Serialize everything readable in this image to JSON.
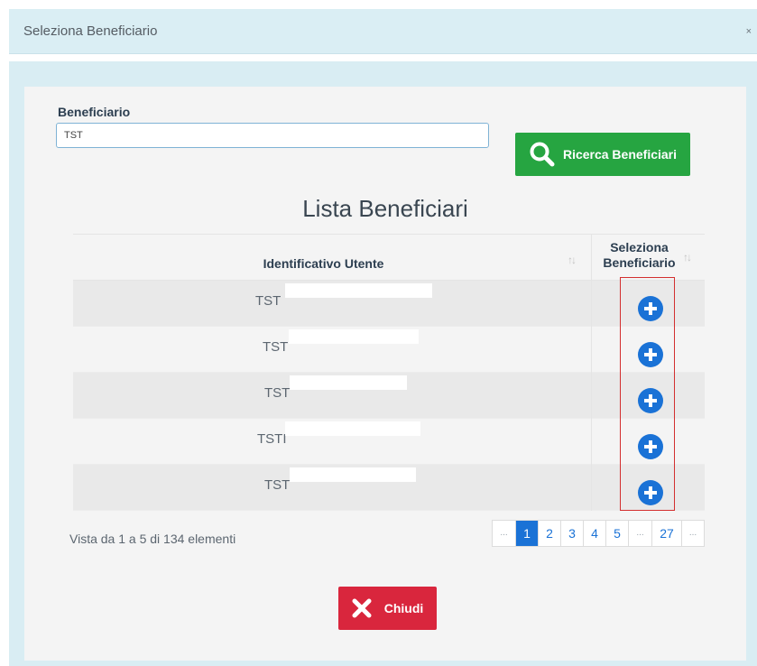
{
  "modal": {
    "title": "Seleziona Beneficiario",
    "close_symbol": "×"
  },
  "search": {
    "label": "Beneficiario",
    "value": "TST",
    "button_label": "Ricerca Beneficiari",
    "button_icon": "search-icon",
    "button_color": "#26a541"
  },
  "list": {
    "title": "Lista Beneficiari",
    "columns": [
      "Identificativo Utente",
      "Seleziona Beneficiario"
    ],
    "sort_icon": "sort-icon",
    "rows": [
      {
        "id": "TST"
      },
      {
        "id": "TST"
      },
      {
        "id": "TST"
      },
      {
        "id": "TSTI"
      },
      {
        "id": "TST"
      }
    ],
    "select_icon": "plus-circle-icon",
    "select_color": "#1a72d6"
  },
  "pagination": {
    "info": "Vista da 1 a 5 di 134 elementi",
    "pages": [
      "...",
      "1",
      "2",
      "3",
      "4",
      "5",
      "...",
      "27",
      "..."
    ],
    "active": "1"
  },
  "footer": {
    "close_label": "Chiudi",
    "close_icon": "x-icon",
    "close_color": "#d9263d"
  }
}
